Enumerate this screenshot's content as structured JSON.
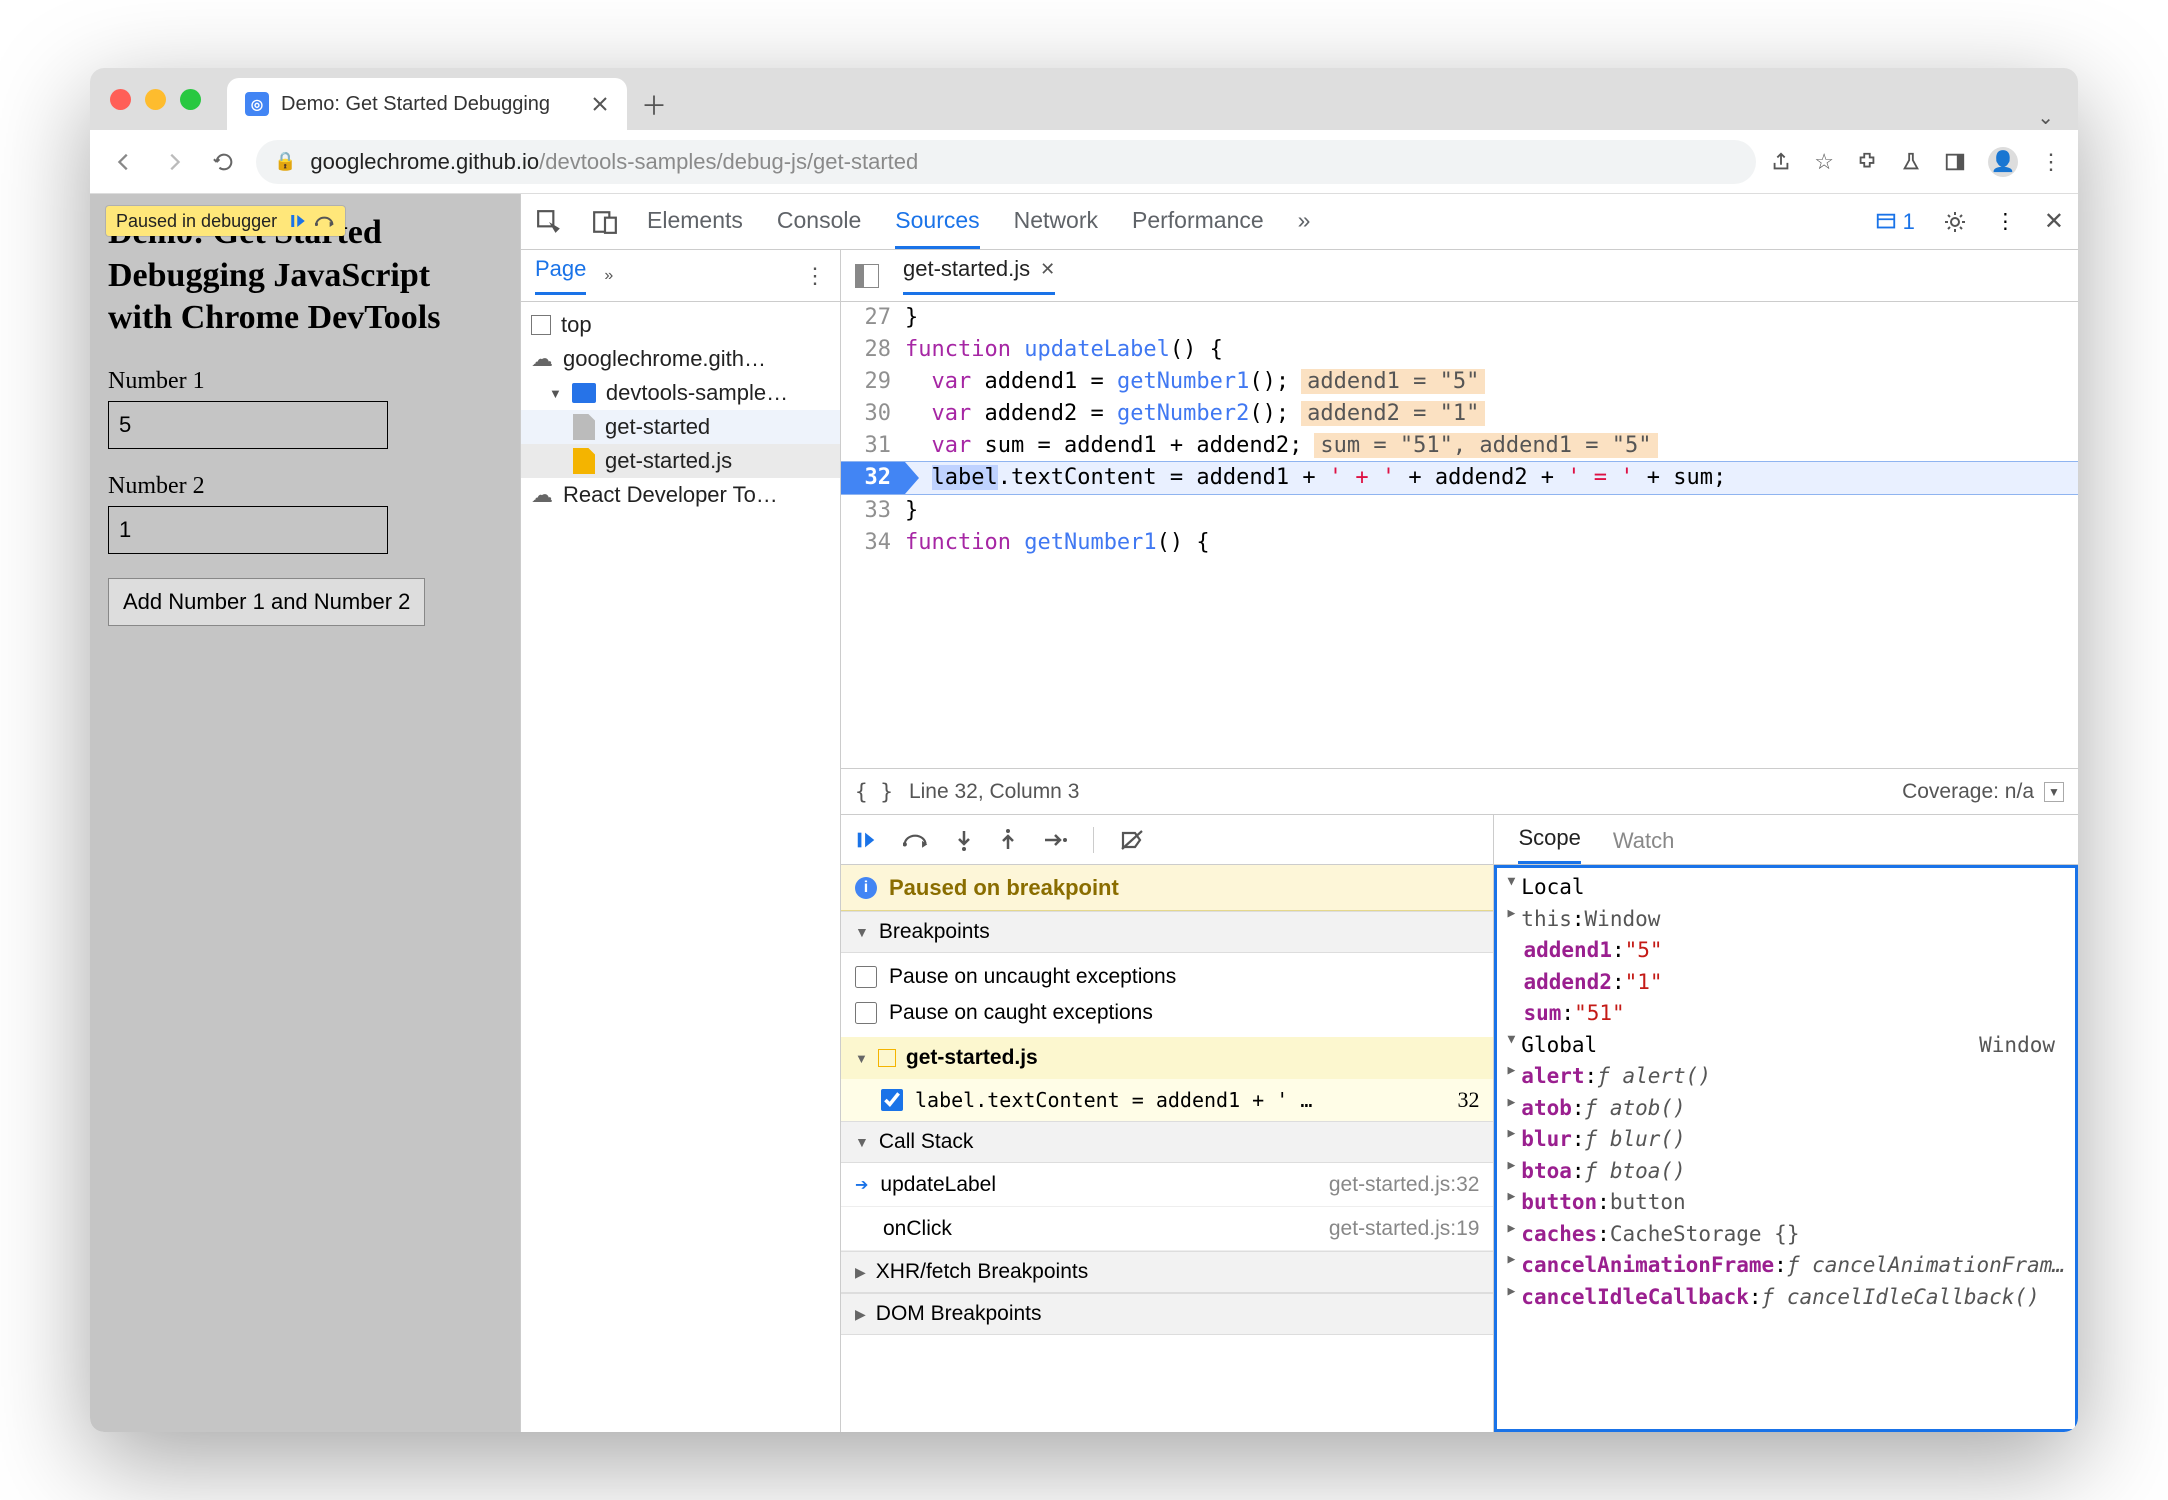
{
  "browser": {
    "tab_title": "Demo: Get Started Debugging",
    "url_host": "googlechrome.github.io",
    "url_path": "/devtools-samples/debug-js/get-started"
  },
  "page": {
    "paused_badge": "Paused in debugger",
    "heading": "Demo: Get Started Debugging JavaScript with Chrome DevTools",
    "num1_label": "Number 1",
    "num1_value": "5",
    "num2_label": "Number 2",
    "num2_value": "1",
    "button_label": "Add Number 1 and Number 2"
  },
  "devtools": {
    "panels": [
      "Elements",
      "Console",
      "Sources",
      "Network",
      "Performance"
    ],
    "issue_count": "1",
    "nav": {
      "page_label": "Page",
      "tree": {
        "top": "top",
        "origin": "googlechrome.gith…",
        "folder": "devtools-sample…",
        "file_html": "get-started",
        "file_js": "get-started.js",
        "ext": "React Developer To…"
      }
    },
    "open_file": "get-started.js",
    "code": [
      {
        "n": 27,
        "t": "}"
      },
      {
        "n": 28,
        "t": "function updateLabel() {"
      },
      {
        "n": 29,
        "t": "  var addend1 = getNumber1();",
        "hint": "addend1 = \"5\""
      },
      {
        "n": 30,
        "t": "  var addend2 = getNumber2();",
        "hint": "addend2 = \"1\""
      },
      {
        "n": 31,
        "t": "  var sum = addend1 + addend2;",
        "hint": "sum = \"51\", addend1 = \"5\""
      },
      {
        "n": 32,
        "t": "  label.textContent = addend1 + ' + ' + addend2 + ' = ' + sum;"
      },
      {
        "n": 33,
        "t": "}"
      },
      {
        "n": 34,
        "t": "function getNumber1() {"
      }
    ],
    "status": {
      "pos": "Line 32, Column 3",
      "coverage": "Coverage: n/a"
    },
    "dbg": {
      "paused_msg": "Paused on breakpoint",
      "sections": {
        "breakpoints": "Breakpoints",
        "callstack": "Call Stack",
        "xhr": "XHR/fetch Breakpoints",
        "dom": "DOM Breakpoints"
      },
      "pause_uncaught": "Pause on uncaught exceptions",
      "pause_caught": "Pause on caught exceptions",
      "bp_file": "get-started.js",
      "bp_text": "label.textContent = addend1 + ' …",
      "bp_line": "32",
      "stack": [
        {
          "fn": "updateLabel",
          "loc": "get-started.js:32",
          "current": true
        },
        {
          "fn": "onClick",
          "loc": "get-started.js:19",
          "current": false
        }
      ],
      "scope": {
        "tabs": [
          "Scope",
          "Watch"
        ],
        "local_label": "Local",
        "local": [
          {
            "k": "this",
            "v": "Window",
            "expand": true,
            "str": false
          },
          {
            "k": "addend1",
            "v": "\"5\"",
            "str": true
          },
          {
            "k": "addend2",
            "v": "\"1\"",
            "str": true
          },
          {
            "k": "sum",
            "v": "\"51\"",
            "str": true
          }
        ],
        "global_label": "Global",
        "global_right": "Window",
        "global": [
          {
            "k": "alert",
            "v": "f alert()"
          },
          {
            "k": "atob",
            "v": "f atob()"
          },
          {
            "k": "blur",
            "v": "f blur()"
          },
          {
            "k": "btoa",
            "v": "f btoa()"
          },
          {
            "k": "button",
            "v": "button",
            "nf": true
          },
          {
            "k": "caches",
            "v": "CacheStorage {}",
            "nf": true
          },
          {
            "k": "cancelAnimationFrame",
            "v": "f cancelAnimationFram…"
          },
          {
            "k": "cancelIdleCallback",
            "v": "f cancelIdleCallback()"
          }
        ]
      }
    }
  }
}
